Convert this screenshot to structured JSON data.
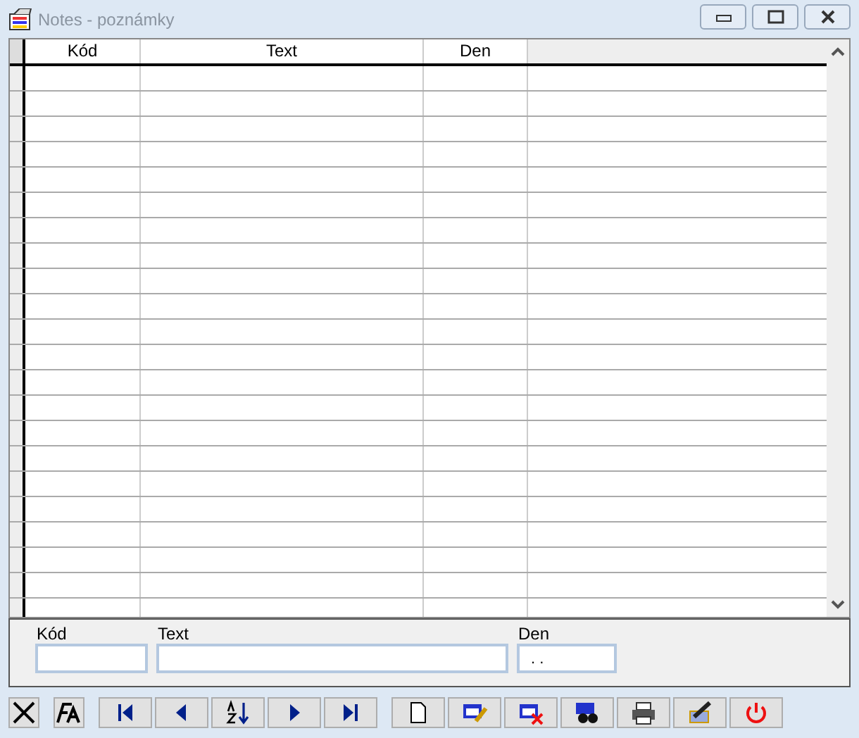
{
  "window": {
    "title": "Notes - poznámky"
  },
  "table": {
    "columns": [
      "Kód",
      "Text",
      "Den"
    ]
  },
  "form": {
    "fields": [
      {
        "label": "Kód"
      },
      {
        "label": "Text"
      },
      {
        "label": "Den",
        "value": ". ."
      }
    ]
  }
}
